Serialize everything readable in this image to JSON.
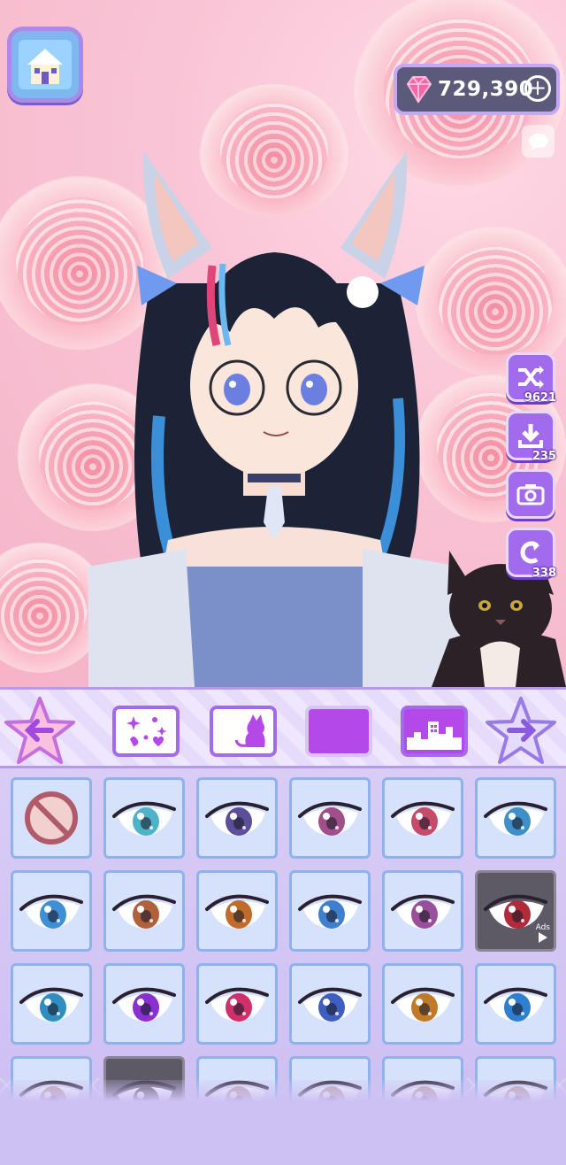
{
  "currency": {
    "gems": "729,390"
  },
  "side_buttons": [
    {
      "name": "random",
      "icon": "shuffle-icon",
      "count": "9621"
    },
    {
      "name": "save",
      "icon": "download-icon",
      "count": "235"
    },
    {
      "name": "camera",
      "icon": "camera-icon",
      "count": ""
    },
    {
      "name": "undo",
      "icon": "undo-icon",
      "count": "338"
    }
  ],
  "category_tabs": [
    {
      "name": "stickers",
      "icon": "sparkle-stickers-icon"
    },
    {
      "name": "pet",
      "icon": "cat-silhouette-icon"
    },
    {
      "name": "background-color",
      "icon": "color-swatch-icon"
    },
    {
      "name": "background-scene",
      "icon": "city-skyline-icon"
    }
  ],
  "eye_grid": {
    "rows": [
      [
        {
          "type": "none"
        },
        {
          "iris": "#4fb3c8"
        },
        {
          "iris": "#5b4f9a"
        },
        {
          "iris": "#a04f88"
        },
        {
          "iris": "#c64a6a"
        },
        {
          "iris": "#3f90c8"
        }
      ],
      [
        {
          "iris": "#3f8fd6"
        },
        {
          "iris": "#b0603a"
        },
        {
          "iris": "#c06b2a"
        },
        {
          "iris": "#3f7fd0"
        },
        {
          "iris": "#9a4f9a"
        },
        {
          "iris": "#b02a3a",
          "ads": true,
          "ads_label": "Ads"
        }
      ],
      [
        {
          "iris": "#2f8ec0"
        },
        {
          "iris": "#8a2fd0"
        },
        {
          "iris": "#d0306a"
        },
        {
          "iris": "#3f5fc0"
        },
        {
          "iris": "#c07a2a"
        },
        {
          "iris": "#2f7fd0"
        }
      ],
      [
        {
          "iris": "#c0a0a0"
        },
        {
          "iris": "#555",
          "ads": true
        },
        {
          "iris": "#c0a0a0"
        },
        {
          "iris": "#c0a0a0"
        },
        {
          "iris": "#c0a0a0"
        },
        {
          "iris": "#c0a0a0"
        }
      ]
    ]
  },
  "colors": {
    "accent_purple": "#a26bee",
    "tab_fill": "#b548e8",
    "cell_border": "#8fb2ec"
  }
}
